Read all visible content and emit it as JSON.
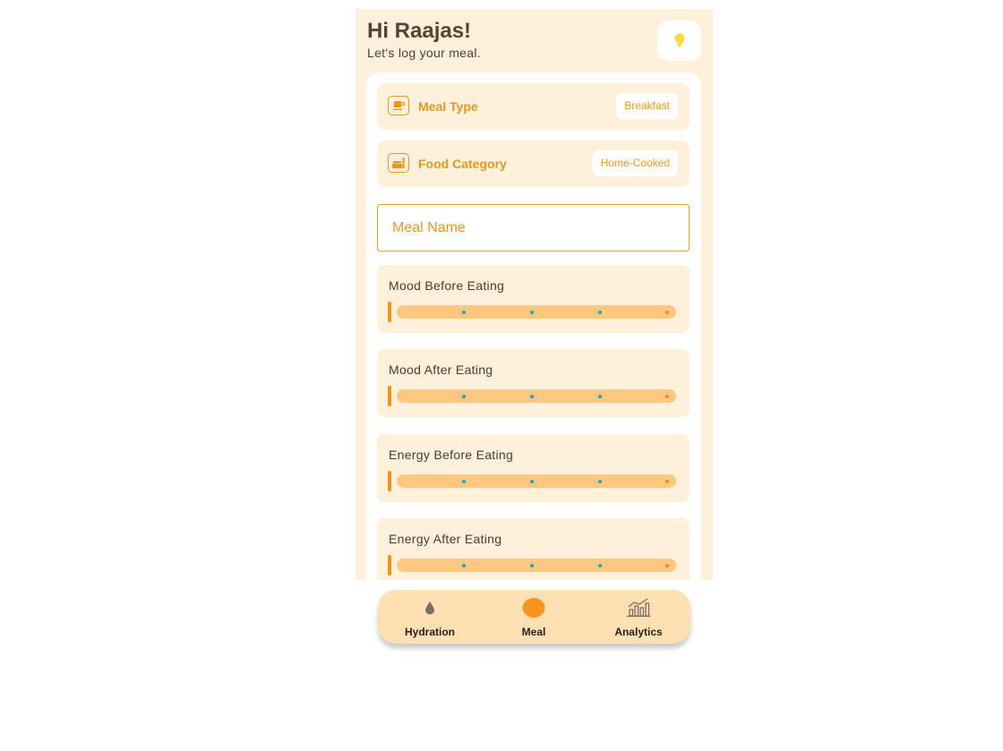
{
  "header": {
    "greeting": "Hi Raajas!",
    "subtitle": "Let's log your meal.",
    "tip_icon": "lightbulb-icon"
  },
  "meal_type": {
    "label": "Meal Type",
    "value": "Breakfast",
    "icon": "cup-icon"
  },
  "food_category": {
    "label": "Food Category",
    "value": "Home-Cooked",
    "icon": "cake-icon"
  },
  "meal_name": {
    "placeholder": "Meal Name",
    "value": ""
  },
  "sliders": [
    {
      "title": "Mood Before Eating",
      "value": 0
    },
    {
      "title": "Mood After Eating",
      "value": 0
    },
    {
      "title": "Energy Before Eating",
      "value": 0
    },
    {
      "title": "Energy After Eating",
      "value": 0
    }
  ],
  "nav": {
    "items": [
      {
        "label": "Hydration",
        "icon": "water-drop-icon",
        "active": false
      },
      {
        "label": "Meal",
        "icon": "meal-dot-icon",
        "active": true
      },
      {
        "label": "Analytics",
        "icon": "bar-chart-icon",
        "active": false
      }
    ]
  },
  "colors": {
    "background": "#fff0dc",
    "accent": "#e39a1c",
    "track": "#ffc880",
    "thumb": "#f39418",
    "tick": "#1ba7b5",
    "nav_bg": "#ffe0b2",
    "active_nav": "#f7941d",
    "text_dark": "#5b4033"
  }
}
